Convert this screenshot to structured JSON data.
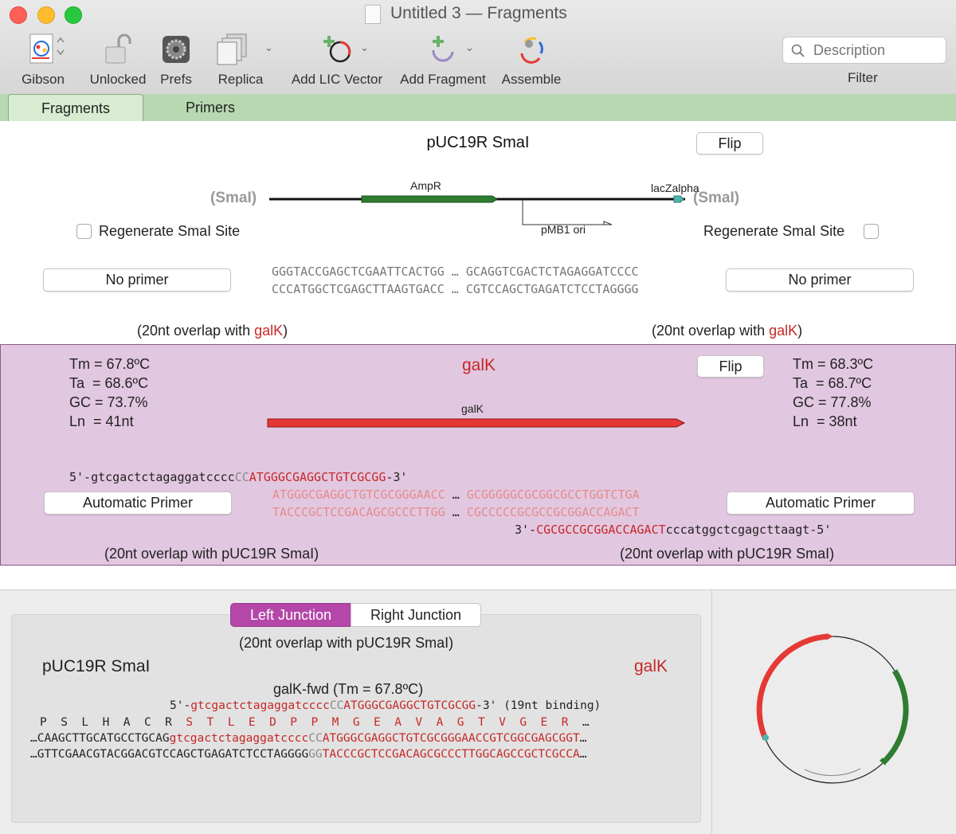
{
  "window": {
    "title": "Untitled 3 — Fragments"
  },
  "toolbar": {
    "gibson": "Gibson",
    "unlocked": "Unlocked",
    "prefs": "Prefs",
    "replica": "Replica",
    "add_lic": "Add LIC Vector",
    "add_fragment": "Add Fragment",
    "assemble": "Assemble",
    "filter_label": "Filter",
    "search_placeholder": "Description"
  },
  "tabs": [
    "Fragments",
    "Primers"
  ],
  "vector": {
    "name": "pUC19R SmaI",
    "flip": "Flip",
    "left_site": "(SmaI)",
    "right_site": "(SmaI)",
    "features": [
      "AmpR",
      "lacZalpha",
      "pMB1 ori"
    ],
    "regen_left": "Regenerate SmaI Site",
    "regen_right": "Regenerate SmaI Site",
    "left_primer": "No primer",
    "right_primer": "No primer",
    "seq_top_left": "GGGTACCGAGCTCGAATTCACTGG",
    "seq_top_right": "GCAGGTCGACTCTAGAGGATCCCC",
    "seq_bot_left": "CCCATGGCTCGAGCTTAAGTGACC",
    "seq_bot_right": "CGTCCAGCTGAGATCTCCTAGGGG",
    "ellipsis": "…",
    "overlap_prefix": "(20nt overlap with ",
    "overlap_target": "galK",
    "overlap_suffix": ")"
  },
  "fragment": {
    "name": "galK",
    "flip": "Flip",
    "feature": "galK",
    "left_stats": [
      "Tm = 67.8ºC",
      "Ta  = 68.6ºC",
      "GC = 73.7%",
      "Ln  = 41nt"
    ],
    "right_stats": [
      "Tm = 68.3ºC",
      "Ta  = 68.7ºC",
      "GC = 77.8%",
      "Ln  = 38nt"
    ],
    "fwd_5": "5'-",
    "fwd_tail": "gtcgactctagaggatcccc",
    "fwd_gray": "CC",
    "fwd_bind": "ATGGGCGAGGCTGTCGCGG",
    "fwd_3": "-3'",
    "seq_top_left": "ATGGGCGAGGCTGTCGCGGGAACC",
    "seq_top_right": "GCGGGGGCGCGGCGCCTGGTCTGA",
    "seq_bot_left": "TACCCGCTCCGACAGCGCCCTTGG",
    "seq_bot_right": "CGCCCCCGCGCCGCGGACCAGACT",
    "rev_3": "3'-",
    "rev_bind": "CGCGCCGCGGACCAGACT",
    "rev_tail": "cccatggctcgagcttaagt",
    "rev_5": "-5'",
    "left_primer": "Automatic Primer",
    "right_primer": "Automatic Primer",
    "overlap_left": "(20nt overlap with pUC19R SmaI)",
    "overlap_right": "(20nt overlap with pUC19R SmaI)"
  },
  "junction": {
    "tabs": [
      "Left Junction",
      "Right Junction"
    ],
    "overlap": "(20nt overlap with pUC19R SmaI)",
    "left_name": "pUC19R SmaI",
    "right_name": "galK",
    "primer_title": "galK-fwd (Tm = 67.8ºC)",
    "primer_5": "5'-",
    "primer_tail": "gtcgactctagaggatcccc",
    "primer_gray": "CC",
    "primer_bind": "ATGGGCGAGGCTGTCGCGG",
    "primer_3": "-3' (19nt binding)",
    "aa_black": "P  S  L  H  A  C  R  ",
    "aa_red": "S  T  L  E  D  P  P  M  G  E  A  V  A  G  T  V  G  E  R  ",
    "aa_end": "…",
    "top_black": "…CAAGCTTGCATGCCTGCAG",
    "top_red_lower": "gtcgactctagaggatcccc",
    "top_gray": "CC",
    "top_red_upper": "ATGGGCGAGGCTGTCGCGGGAACCGTCGGCGAGCGGT",
    "top_end": "…",
    "bot_black": "…GTTCGAACGTACGGACGTCCAGCTGAGATCTCCTAGGGG",
    "bot_gray": "GG",
    "bot_red": "TACCCGCTCCGACAGCGCCCTTGGCAGCCGCTCGCCA",
    "bot_end": "…"
  },
  "colors": {
    "fragment_bg": "#e2c7e0",
    "tab_bg": "#b7d8b0",
    "feature_green": "#2e7d32",
    "feature_red": "#e53935",
    "accent_red": "#c62828",
    "junction_tab_active": "#b447a8"
  }
}
